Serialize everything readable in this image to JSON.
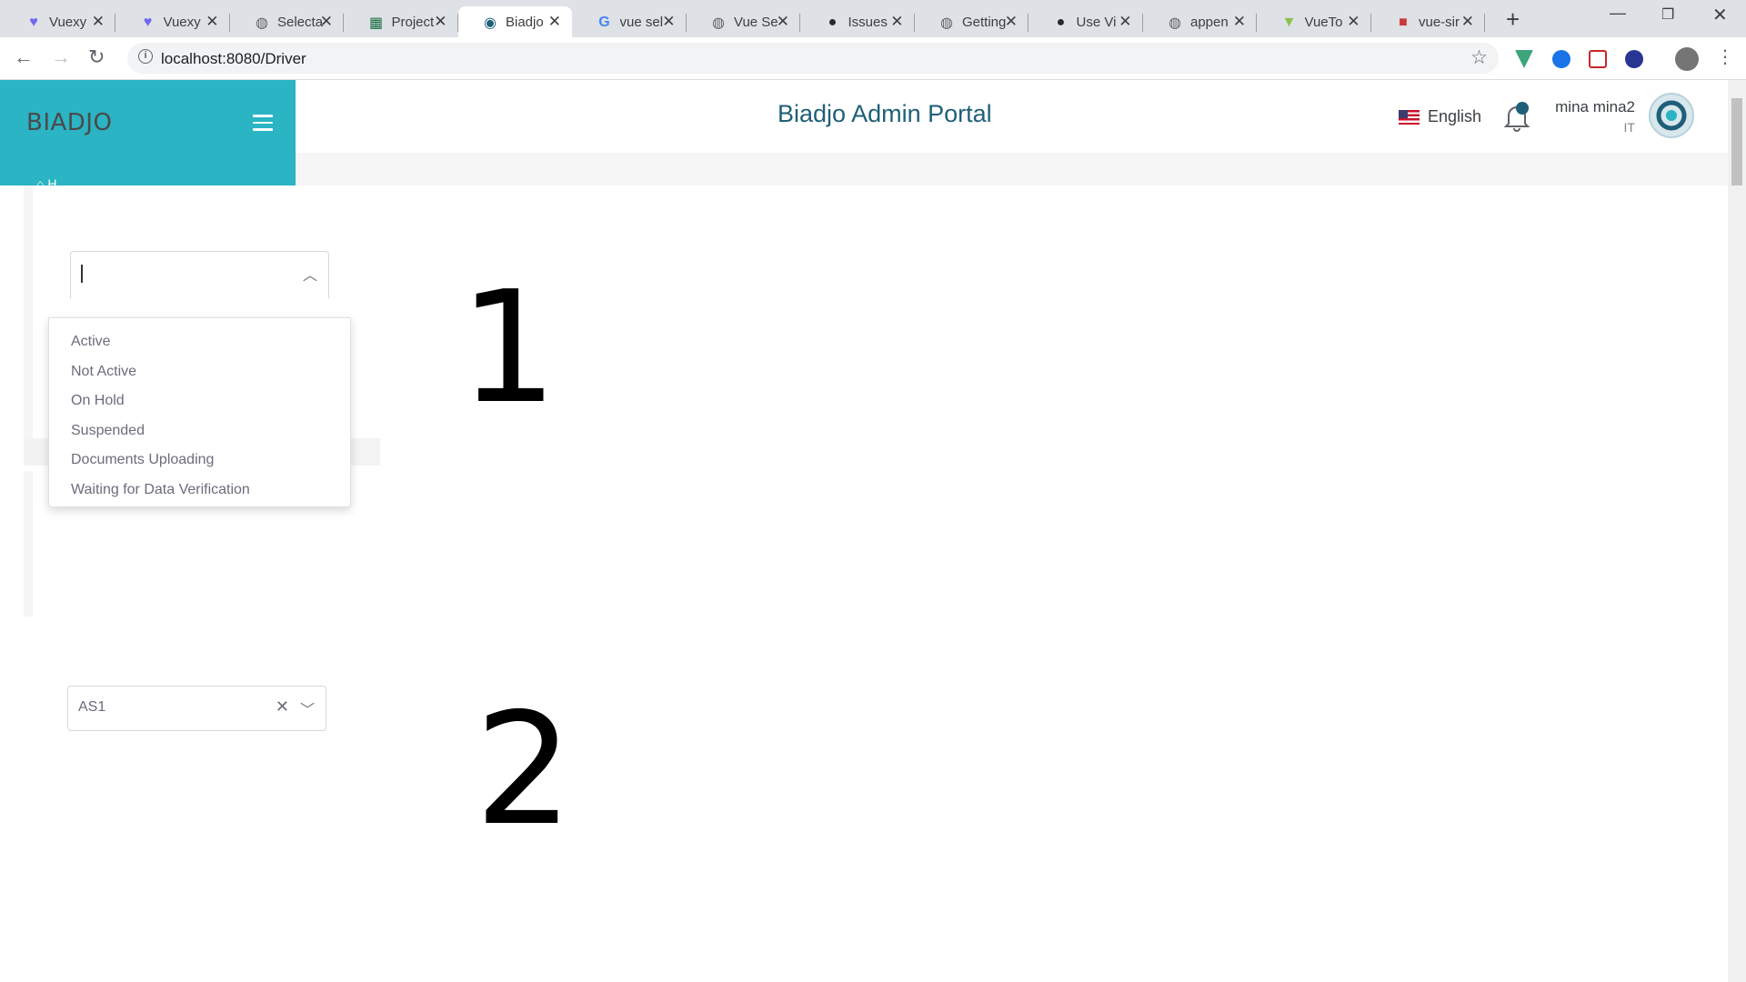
{
  "browser": {
    "tabs": [
      {
        "title": "Vuexy",
        "icon": "vuexy-icon",
        "active": false
      },
      {
        "title": "Vuexy",
        "icon": "vuexy-icon",
        "active": false
      },
      {
        "title": "Selecta",
        "icon": "globe-icon",
        "active": false
      },
      {
        "title": "Project",
        "icon": "excel-icon",
        "active": false
      },
      {
        "title": "Biadjo",
        "icon": "biadjo-icon",
        "active": true
      },
      {
        "title": "vue sel",
        "icon": "google-icon",
        "active": false
      },
      {
        "title": "Vue Se",
        "icon": "globe-icon",
        "active": false
      },
      {
        "title": "Issues",
        "icon": "github-icon",
        "active": false
      },
      {
        "title": "Getting",
        "icon": "globe-icon",
        "active": false
      },
      {
        "title": "Use Vi",
        "icon": "github-icon",
        "active": false
      },
      {
        "title": "appen",
        "icon": "globe-icon",
        "active": false
      },
      {
        "title": "VueTo",
        "icon": "vuetour-icon",
        "active": false
      },
      {
        "title": "vue-sir",
        "icon": "npm-icon",
        "active": false
      }
    ],
    "url": "localhost:8080/Driver"
  },
  "sidebar": {
    "brand": "BIADJO"
  },
  "header": {
    "title": "Biadjo Admin Portal",
    "language": "English",
    "user_name": "mina mina2",
    "user_role": "IT"
  },
  "select1": {
    "value": "",
    "open": true,
    "options": [
      "Active",
      "Not Active",
      "On Hold",
      "Suspended",
      "Documents Uploading",
      "Waiting for Data Verification"
    ]
  },
  "annotations": {
    "label1": "1",
    "label2": "2"
  },
  "select2": {
    "value": "AS1",
    "open": false
  },
  "colors": {
    "brand_bg": "#2ab4c4",
    "title": "#1f5f78",
    "option_text": "#6e6b7b"
  }
}
